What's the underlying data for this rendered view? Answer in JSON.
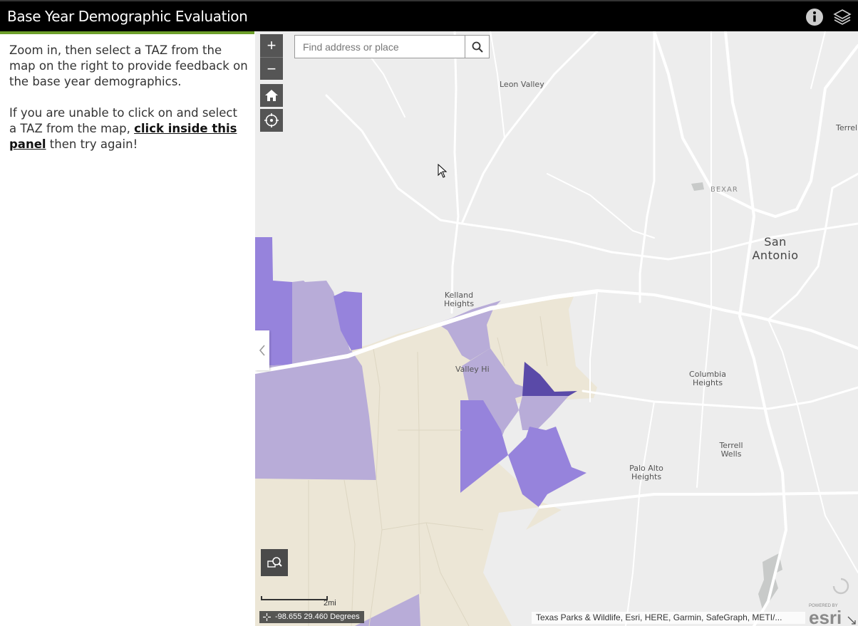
{
  "header": {
    "title": "Base Year Demographic Evaluation",
    "info_icon": "info-icon",
    "layers_icon": "layers-icon"
  },
  "panel": {
    "instruction": "Zoom in, then select a TAZ from the map on the right to provide feedback on the base year  demographics.",
    "help_prefix": "If you are unable to click on and select a TAZ from the map, ",
    "help_link": "click inside this panel",
    "help_suffix": " then try again!"
  },
  "map": {
    "search": {
      "placeholder": "Find address or place"
    },
    "zoom_in_label": "+",
    "zoom_out_label": "−",
    "labels": {
      "leon_valley": "Leon Valley",
      "terrell_h": "Terrell H",
      "bexar": "BEXAR",
      "san_antonio_1": "San",
      "san_antonio_2": "Antonio",
      "kelland_1": "Kelland",
      "kelland_2": "Heights",
      "valley_hi": "Valley Hi",
      "columbia_1": "Columbia",
      "columbia_2": "Heights",
      "terrell_wells_1": "Terrell",
      "terrell_wells_2": "Wells",
      "palo_alto_1": "Palo Alto",
      "palo_alto_2": "Heights"
    },
    "scale_label": "2mi",
    "coordinates": "-98.655 29.460 Degrees",
    "attribution": "Texas Parks & Wildlife, Esri, HERE, Garmin, SafeGraph, METI/...",
    "colors": {
      "taz_tan": "#ece6d6",
      "taz_light": "#b8acd8",
      "taz_medium": "#9683dc",
      "taz_dark": "#5a4aa8",
      "background": "#ededed",
      "road": "#ffffff"
    }
  }
}
